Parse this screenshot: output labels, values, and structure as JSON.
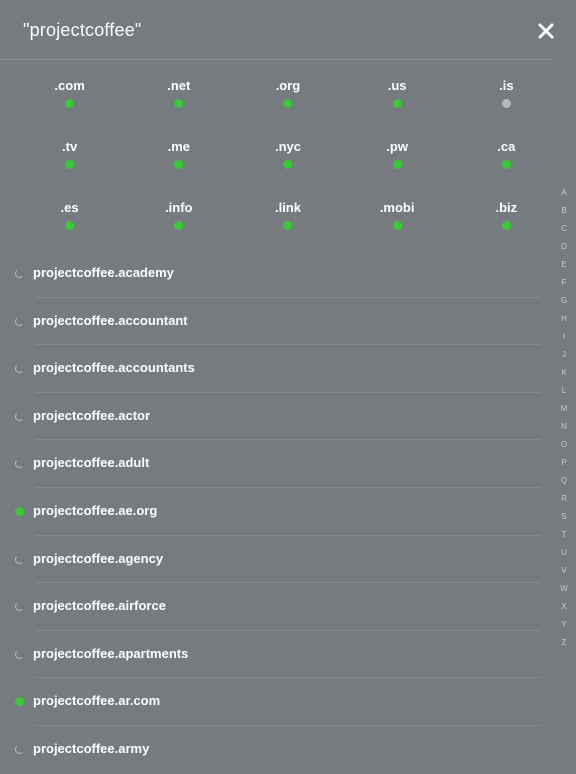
{
  "header": {
    "title": "\"projectcoffee\"",
    "close_icon": "close-icon"
  },
  "colors": {
    "background": "#767b80",
    "available": "#33cc33",
    "unavailable": "#b6b9bc",
    "text": "#ffffff"
  },
  "tlds": [
    {
      "label": ".com",
      "available": true
    },
    {
      "label": ".net",
      "available": true
    },
    {
      "label": ".org",
      "available": true
    },
    {
      "label": ".us",
      "available": true
    },
    {
      "label": ".is",
      "available": false
    },
    {
      "label": ".tv",
      "available": true
    },
    {
      "label": ".me",
      "available": true
    },
    {
      "label": ".nyc",
      "available": true
    },
    {
      "label": ".pw",
      "available": true
    },
    {
      "label": ".ca",
      "available": true
    },
    {
      "label": ".es",
      "available": true
    },
    {
      "label": ".info",
      "available": true
    },
    {
      "label": ".link",
      "available": true
    },
    {
      "label": ".mobi",
      "available": true
    },
    {
      "label": ".biz",
      "available": true
    }
  ],
  "index_letters": [
    "A",
    "B",
    "C",
    "D",
    "E",
    "F",
    "G",
    "H",
    "I",
    "J",
    "K",
    "L",
    "M",
    "N",
    "O",
    "P",
    "Q",
    "R",
    "S",
    "T",
    "U",
    "V",
    "W",
    "X",
    "Y",
    "Z"
  ],
  "domains": [
    {
      "name": "projectcoffee.academy",
      "status": "loading"
    },
    {
      "name": "projectcoffee.accountant",
      "status": "loading"
    },
    {
      "name": "projectcoffee.accountants",
      "status": "loading"
    },
    {
      "name": "projectcoffee.actor",
      "status": "loading"
    },
    {
      "name": "projectcoffee.adult",
      "status": "loading"
    },
    {
      "name": "projectcoffee.ae.org",
      "status": "available"
    },
    {
      "name": "projectcoffee.agency",
      "status": "loading"
    },
    {
      "name": "projectcoffee.airforce",
      "status": "loading"
    },
    {
      "name": "projectcoffee.apartments",
      "status": "loading"
    },
    {
      "name": "projectcoffee.ar.com",
      "status": "available"
    },
    {
      "name": "projectcoffee.army",
      "status": "loading"
    }
  ]
}
